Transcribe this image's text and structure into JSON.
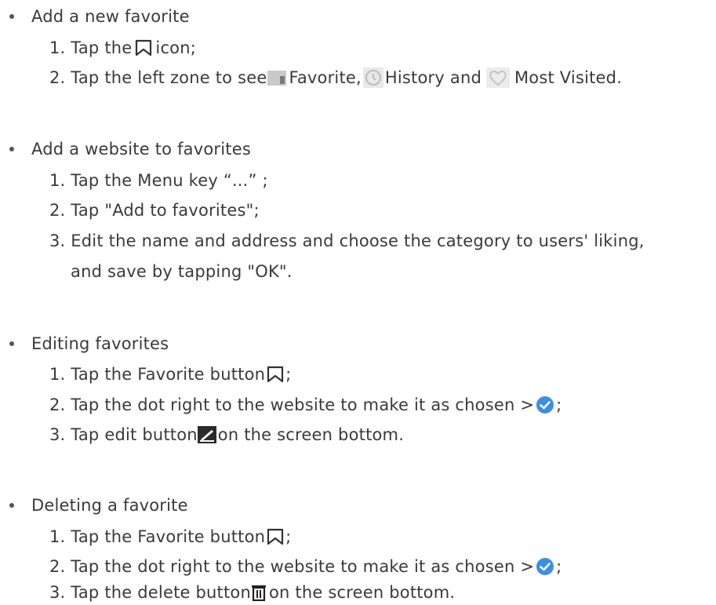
{
  "sections": [
    {
      "title": "Add a new favorite",
      "steps": [
        {
          "pre": "1. Tap the ",
          "post": "icon;"
        },
        {
          "pre": "2. Tap the left zone to see",
          "a": "Favorite,",
          "b": "History and",
          "c": "Most Visited."
        }
      ]
    },
    {
      "title": "Add a website to favorites",
      "steps": [
        {
          "text": "1. Tap the Menu key   “...”  ;"
        },
        {
          "text": "2. Tap \"Add to favorites\";"
        },
        {
          "text": "3. Edit the name and address and choose the category to users' liking,"
        },
        {
          "text": "and save by tapping \"OK\"."
        }
      ]
    },
    {
      "title": "Editing favorites",
      "steps": [
        {
          "pre": "1. Tap the Favorite button ",
          "post": ";"
        },
        {
          "pre": "2. Tap the dot right to the website to make it as chosen > ",
          "post": ";"
        },
        {
          "pre": "3. Tap edit button ",
          "post": "on the screen bottom."
        }
      ]
    },
    {
      "title": "Deleting a favorite",
      "steps": [
        {
          "pre": "1. Tap the Favorite button ",
          "post": ";"
        },
        {
          "pre": "2. Tap the dot right to the website to make it as chosen > ",
          "post": ";"
        },
        {
          "pre": "3. Tap the delete button ",
          "post": "on the screen bottom."
        }
      ]
    }
  ],
  "icons": {
    "bookmark": "bookmark-icon",
    "folder": "folder-icon",
    "clock": "clock-icon",
    "heart": "heart-icon",
    "check": "check-circle-icon",
    "edit": "edit-icon",
    "trash": "trash-icon"
  },
  "colors": {
    "text": "#3a3a3a",
    "check_blue": "#3b8fe0",
    "light_gray": "#cfcfcf"
  }
}
